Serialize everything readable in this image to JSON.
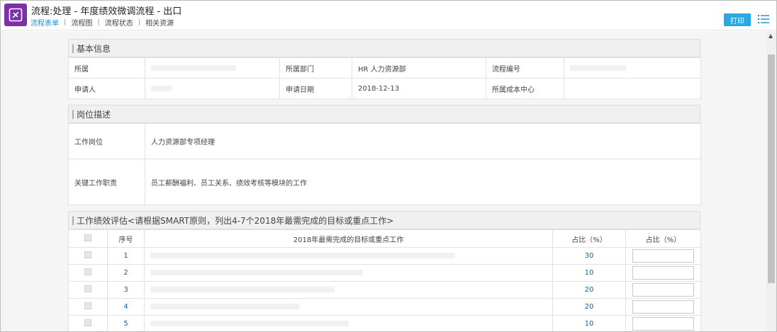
{
  "header": {
    "title": "流程:处理 - 年度绩效微调流程 - 出口",
    "tabs": [
      "流程表单",
      "流程图",
      "流程状态",
      "相关资源"
    ],
    "print_label": "打印"
  },
  "colors": {
    "accent": "#1a8fd6",
    "print_button": "#29a8e6",
    "app_icon": "#7b2fa8"
  },
  "basic_info": {
    "heading": "基本信息",
    "rows": [
      {
        "l1": "所属",
        "v1": "",
        "l2": "所属部门",
        "v2": "HR 人力资源部",
        "l3": "流程编号",
        "v3": ""
      },
      {
        "l1": "申请人",
        "v1": "",
        "l2": "申请日期",
        "v2": "2018-12-13",
        "l3": "所属成本中心",
        "v3": ""
      }
    ]
  },
  "position": {
    "heading": "岗位描述",
    "position_label": "工作岗位",
    "position_value": "人力资源部专项经理",
    "duty_label": "关键工作职责",
    "duty_value": "员工薪酬福利、员工关系、绩效考核等模块的工作"
  },
  "performance": {
    "heading": "工作绩效评估<请根据SMART原则，列出4-7个2018年最需完成的目标或重点工作>",
    "columns": [
      "序号",
      "2018年最需完成的目标或重点工作",
      "占比（%）",
      "占比（%）"
    ],
    "rows": [
      {
        "index": "1",
        "goal": "",
        "ratio": "30"
      },
      {
        "index": "2",
        "goal": "",
        "ratio": "10"
      },
      {
        "index": "3",
        "goal": "",
        "ratio": "20"
      },
      {
        "index": "4",
        "goal": "",
        "ratio": "20"
      },
      {
        "index": "5",
        "goal": "",
        "ratio": "10"
      }
    ]
  }
}
